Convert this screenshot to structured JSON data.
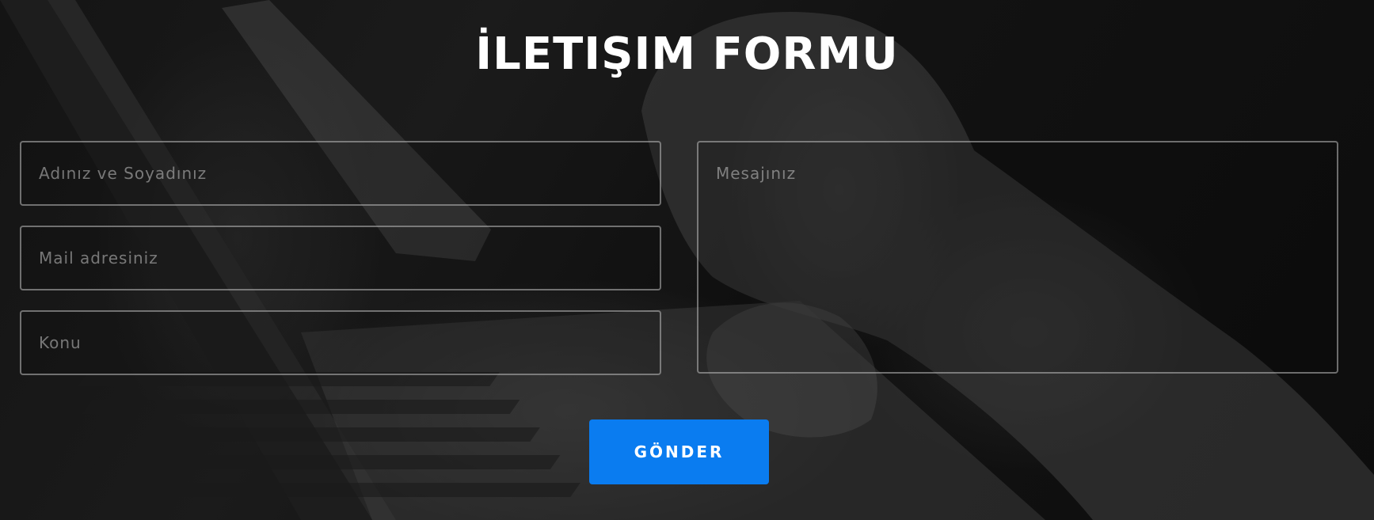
{
  "form": {
    "title": "İLETIŞIM FORMU",
    "fields": {
      "name_placeholder": "Adınız ve Soyadınız",
      "email_placeholder": "Mail adresiniz",
      "subject_placeholder": "Konu",
      "message_placeholder": "Mesajınız"
    },
    "submit_label": "GÖNDER"
  },
  "colors": {
    "accent": "#0a7cf0",
    "title_text": "#ffffff",
    "field_border": "#9a9a9a"
  }
}
